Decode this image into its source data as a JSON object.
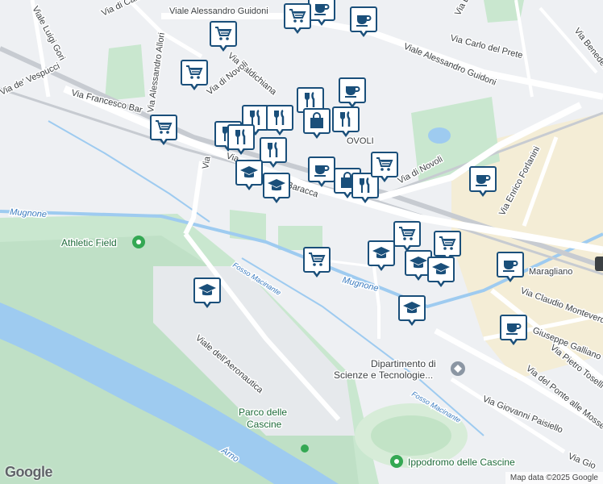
{
  "map": {
    "streets": [
      {
        "id": "viale-luigi-gori",
        "text": "Viale Luigi Gori"
      },
      {
        "id": "via-di-carraia",
        "text": "Via di Carraia"
      },
      {
        "id": "viale-alessandro-guidoni-top",
        "text": "Viale Alessandro Guidoni"
      },
      {
        "id": "via-carlo-del-prete",
        "text": "Via Carlo del Prete"
      },
      {
        "id": "viale-alessandro-guidoni",
        "text": "Viale Alessandro Guidoni"
      },
      {
        "id": "via-alessandro-allori",
        "text": "Via Alessandro Allori"
      },
      {
        "id": "via-valdichiana",
        "text": "Via Valdichiana"
      },
      {
        "id": "via-di-novoli-top",
        "text": "Via di Novoli"
      },
      {
        "id": "viale-de-vespucci",
        "text": "Via de' Vespucci"
      },
      {
        "id": "via-francesco-bar",
        "text": "Via Francesco Bar"
      },
      {
        "id": "via-baracca-start",
        "text": "Via"
      },
      {
        "id": "via-baracca",
        "text": "Baracca"
      },
      {
        "id": "via-di-novoli",
        "text": "Via di Novoli"
      },
      {
        "id": "via-enrico-forlanini",
        "text": "Via Enrico Forlanini"
      },
      {
        "id": "maragliano",
        "text": "Maragliano"
      },
      {
        "id": "via-claudio-monteverdi",
        "text": "Via Claudio Monteverdi"
      },
      {
        "id": "via-giuseppe-galliano",
        "text": "Giuseppe Galliano"
      },
      {
        "id": "via-pietro-toselli",
        "text": "Via Pietro Toselli"
      },
      {
        "id": "via-del-ponte-alle-mosse",
        "text": "Via del Ponte alle Mosse"
      },
      {
        "id": "via-giovanni-paisiello",
        "text": "Via Giovanni Paisiello"
      },
      {
        "id": "via-gio",
        "text": "Via Gio"
      },
      {
        "id": "viale-dell-aeronautica",
        "text": "Viale dell'Aeronautica"
      },
      {
        "id": "via-benedetto",
        "text": "Via Benedetto"
      },
      {
        "id": "via-top-right",
        "text": "Via E"
      },
      {
        "id": "novoli-area",
        "text": "OVOLI"
      },
      {
        "id": "via-left-vertical",
        "text": "Via"
      }
    ],
    "water": [
      {
        "id": "mugnone-left",
        "text": "Mugnone"
      },
      {
        "id": "mugnone-right",
        "text": "Mugnone"
      },
      {
        "id": "fosso-macinante",
        "text": "Fosso Macinante"
      },
      {
        "id": "fosso-macinante-2",
        "text": "Fosso Macinante"
      },
      {
        "id": "arno",
        "text": "Arno"
      }
    ],
    "pois": [
      {
        "id": "athletic-field",
        "text": "Athletic Field"
      },
      {
        "id": "parco-delle-cascine",
        "line1": "Parco delle",
        "line2": "Cascine"
      },
      {
        "id": "dipartimento",
        "line1": "Dipartimento di",
        "line2": "Scienze e Tecnologie..."
      },
      {
        "id": "ippodromo",
        "text": "Ippodromo delle Cascine"
      }
    ],
    "markers": [
      {
        "type": "cafe",
        "icon": "coffee-cup-icon"
      },
      {
        "type": "cafe",
        "icon": "coffee-cup-icon"
      },
      {
        "type": "shop",
        "icon": "shopping-cart-icon"
      },
      {
        "type": "shop",
        "icon": "shopping-cart-icon"
      },
      {
        "type": "shop",
        "icon": "shopping-cart-icon"
      },
      {
        "type": "shop",
        "icon": "shopping-cart-icon"
      },
      {
        "type": "cafe",
        "icon": "coffee-cup-icon"
      },
      {
        "type": "restaurant",
        "icon": "fork-knife-icon"
      },
      {
        "type": "restaurant",
        "icon": "fork-knife-icon"
      },
      {
        "type": "restaurant",
        "icon": "fork-knife-icon"
      },
      {
        "type": "bag",
        "icon": "shopping-bag-icon"
      },
      {
        "type": "restaurant",
        "icon": "fork-knife-icon"
      },
      {
        "type": "restaurant",
        "icon": "fork-knife-icon"
      },
      {
        "type": "restaurant",
        "icon": "fork-knife-icon"
      },
      {
        "type": "restaurant",
        "icon": "fork-knife-icon"
      },
      {
        "type": "school",
        "icon": "graduation-cap-icon"
      },
      {
        "type": "school",
        "icon": "graduation-cap-icon"
      },
      {
        "type": "cafe",
        "icon": "coffee-cup-icon"
      },
      {
        "type": "bag",
        "icon": "shopping-bag-icon"
      },
      {
        "type": "restaurant",
        "icon": "fork-knife-icon"
      },
      {
        "type": "shop",
        "icon": "shopping-cart-icon"
      },
      {
        "type": "cafe",
        "icon": "coffee-cup-icon"
      },
      {
        "type": "shop",
        "icon": "shopping-cart-icon"
      },
      {
        "type": "shop",
        "icon": "shopping-cart-icon"
      },
      {
        "type": "school",
        "icon": "graduation-cap-icon"
      },
      {
        "type": "shop",
        "icon": "shopping-cart-icon"
      },
      {
        "type": "school",
        "icon": "graduation-cap-icon"
      },
      {
        "type": "school",
        "icon": "graduation-cap-icon"
      },
      {
        "type": "cafe",
        "icon": "coffee-cup-icon"
      },
      {
        "type": "school",
        "icon": "graduation-cap-icon"
      },
      {
        "type": "cafe",
        "icon": "coffee-cup-icon"
      },
      {
        "type": "school",
        "icon": "graduation-cap-icon"
      }
    ],
    "attribution": {
      "logo": "Google",
      "credit": "Map data ©2025 Google"
    },
    "colors": {
      "background": "#eef0f3",
      "park": "#c9e7cf",
      "water": "#9ecbf0",
      "road": "#ffffff",
      "highlight_road": "#fdf1c7",
      "marker_border": "#1a4f7a"
    }
  }
}
